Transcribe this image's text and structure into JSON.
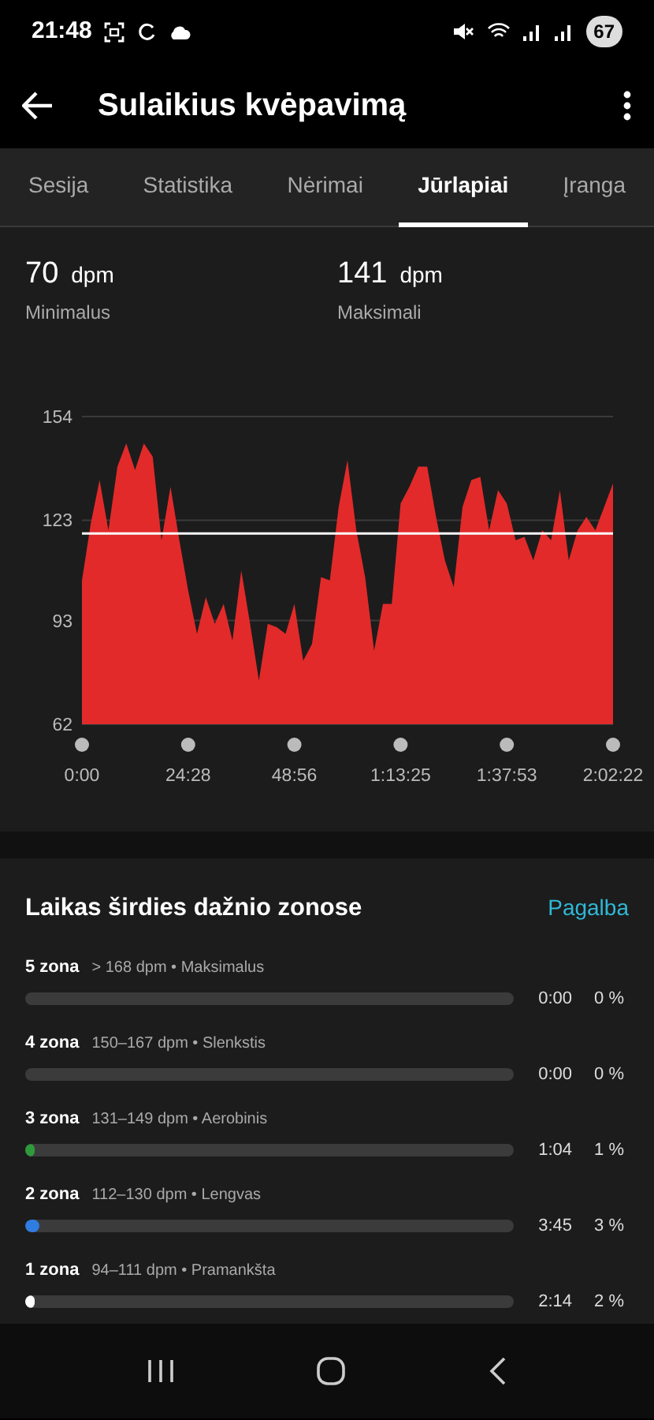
{
  "status_bar": {
    "time": "21:48",
    "battery": "67"
  },
  "app_bar": {
    "title": "Sulaikius kvėpavimą"
  },
  "tabs": [
    {
      "label": "Sesija",
      "selected": false
    },
    {
      "label": "Statistika",
      "selected": false
    },
    {
      "label": "Nėrimai",
      "selected": false
    },
    {
      "label": "Jūrlapiai",
      "selected": true
    },
    {
      "label": "Įranga",
      "selected": false
    }
  ],
  "stats": [
    {
      "value": "70",
      "unit": "dpm",
      "label": "Minimalus"
    },
    {
      "value": "141",
      "unit": "dpm",
      "label": "Maksimali"
    }
  ],
  "heart_chart": {
    "chart_data": {
      "type": "area",
      "ylim": [
        62,
        154
      ],
      "yticks": [
        62,
        93,
        123,
        154
      ],
      "categories": [
        "0:00",
        null,
        null,
        null,
        null,
        null,
        null,
        null,
        null,
        null,
        null,
        null,
        "24:28",
        null,
        null,
        null,
        null,
        null,
        null,
        null,
        null,
        null,
        null,
        null,
        "48:56",
        null,
        null,
        null,
        null,
        null,
        null,
        null,
        null,
        null,
        null,
        null,
        "1:13:25",
        null,
        null,
        null,
        null,
        null,
        null,
        null,
        null,
        null,
        null,
        null,
        "1:37:53",
        null,
        null,
        null,
        null,
        null,
        null,
        null,
        null,
        null,
        null,
        null,
        "2:02:22"
      ],
      "series": [
        {
          "color": "#e22a2a",
          "values": [
            105,
            122,
            135,
            120,
            139,
            146,
            138,
            146,
            142,
            117,
            133,
            117,
            102,
            89,
            100,
            92,
            98,
            87,
            108,
            92,
            75,
            92,
            91,
            89,
            98,
            81,
            86,
            106,
            105,
            127,
            141,
            120,
            106,
            84,
            98,
            98,
            128,
            133,
            139,
            139,
            124,
            111,
            103,
            127,
            135,
            136,
            120,
            132,
            128,
            117,
            118,
            111,
            120,
            117,
            132,
            111,
            120,
            124,
            120,
            127,
            134
          ]
        }
      ],
      "ref_lines": [
        {
          "axis": "y",
          "value": 119
        }
      ]
    }
  },
  "zones_card": {
    "title": "Laikas širdies dažnio zonose",
    "help_link": "Pagalba",
    "zones": [
      {
        "name": "5 zona",
        "range": "> 168 dpm • Maksimalus",
        "time": "0:00",
        "percent": "0 %"
      },
      {
        "name": "4 zona",
        "range": "150–167 dpm • Slenkstis",
        "time": "0:00",
        "percent": "0 %"
      },
      {
        "name": "3 zona",
        "range": "131–149 dpm • Aerobinis",
        "level": 0.01,
        "color": "#2e9a3c",
        "time": "1:04",
        "percent": "1 %"
      },
      {
        "name": "2 zona",
        "range": "112–130 dpm • Lengvas",
        "level": 0.03,
        "color": "#2f7de0",
        "time": "3:45",
        "percent": "3 %"
      },
      {
        "name": "1 zona",
        "range": "94–111 dpm • Pramankšta",
        "level": 0.02,
        "color": "#ffffff",
        "time": "2:14",
        "percent": "2 %"
      }
    ]
  }
}
